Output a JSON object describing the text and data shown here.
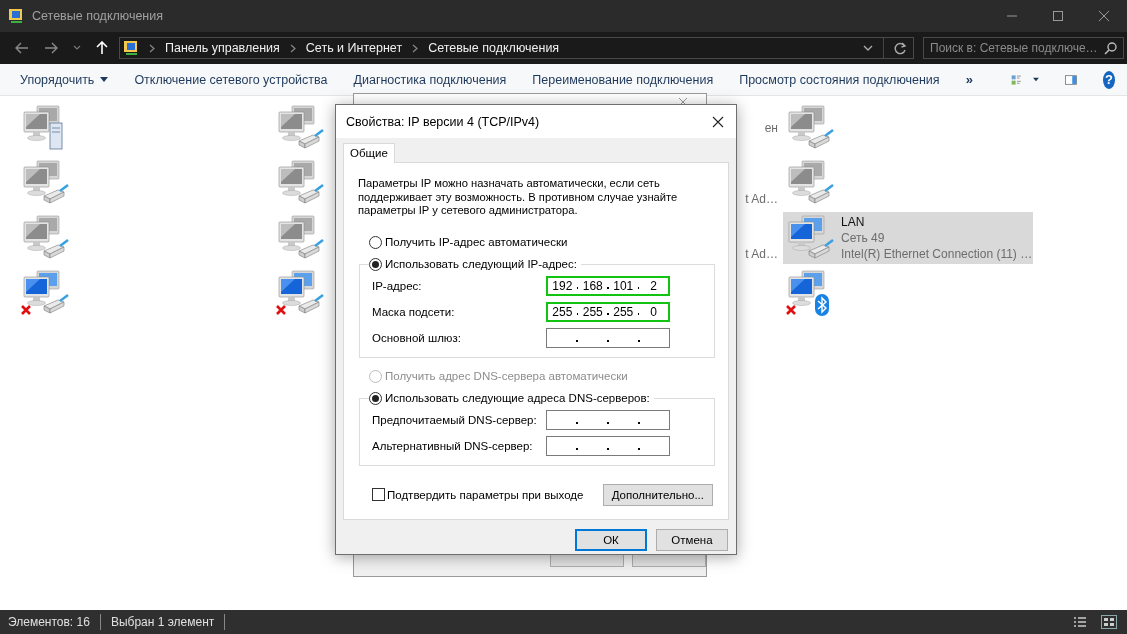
{
  "window": {
    "title": "Сетевые подключения"
  },
  "address_bar": {
    "breadcrumbs": [
      "Панель управления",
      "Сеть и Интернет",
      "Сетевые подключения"
    ]
  },
  "search": {
    "placeholder": "Поиск в: Сетевые подключе…"
  },
  "toolbar": {
    "items": [
      {
        "label": "Упорядочить",
        "kind": "dropdown"
      },
      {
        "label": "Отключение сетевого устройства",
        "kind": "command"
      },
      {
        "label": "Диагностика подключения",
        "kind": "command"
      },
      {
        "label": "Переименование подключения",
        "kind": "command"
      },
      {
        "label": "Просмотр состояния подключения",
        "kind": "command"
      }
    ],
    "overflow": "»",
    "help": "?"
  },
  "connections": {
    "columns": [
      [
        {
          "kind": "server",
          "connected": false,
          "disabled": false,
          "selected": false
        },
        {
          "kind": "ethernet",
          "connected": false,
          "disabled": false,
          "selected": false
        },
        {
          "kind": "ethernet",
          "connected": false,
          "disabled": false,
          "selected": false
        },
        {
          "kind": "ethernet",
          "connected": true,
          "disabled": true,
          "selected": false
        }
      ],
      [
        {
          "kind": "ethernet",
          "connected": false,
          "disabled": false,
          "selected": false
        },
        {
          "kind": "ethernet",
          "connected": false,
          "disabled": false,
          "selected": false
        },
        {
          "kind": "ethernet",
          "connected": false,
          "disabled": false,
          "selected": false
        },
        {
          "kind": "ethernet",
          "connected": true,
          "disabled": true,
          "selected": false
        }
      ],
      [
        {
          "status": "ен",
          "selected": false
        },
        {
          "adapter": "t Ad…",
          "selected": false
        },
        {
          "adapter": "t Ad…",
          "selected": false
        }
      ],
      [
        {
          "kind": "ethernet",
          "connected": false,
          "disabled": false,
          "selected": false
        },
        {
          "kind": "ethernet",
          "connected": false,
          "disabled": false,
          "selected": false
        },
        {
          "kind": "ethernet",
          "connected": true,
          "disabled": false,
          "selected": true,
          "name": "LAN",
          "status": "Сеть 49",
          "adapter": "Intel(R) Ethernet Connection (11) …"
        },
        {
          "kind": "bluetooth",
          "connected": true,
          "disabled": true,
          "selected": false
        }
      ]
    ]
  },
  "ip_dialog": {
    "title": "Свойства: IP версии 4 (TCP/IPv4)",
    "tabs": [
      {
        "label": "Общие",
        "selected": true
      }
    ],
    "description": "Параметры IP можно назначать автоматически, если сеть поддерживает эту возможность. В противном случае узнайте параметры IP у сетевого администратора.",
    "ip_section": {
      "auto_option": {
        "label": "Получить IP-адрес автоматически",
        "selected": false,
        "disabled": false
      },
      "manual_option": {
        "label": "Использовать следующий IP-адрес:",
        "selected": true,
        "disabled": false
      },
      "fields": [
        {
          "label": "IP-адрес:",
          "octets": [
            "192",
            "168",
            "101",
            "2"
          ],
          "highlighted": true
        },
        {
          "label": "Маска подсети:",
          "octets": [
            "255",
            "255",
            "255",
            "0"
          ],
          "highlighted": true
        },
        {
          "label": "Основной шлюз:",
          "highlighted": false
        }
      ]
    },
    "dns_section": {
      "auto_option": {
        "label": "Получить адрес DNS-сервера автоматически",
        "selected": false,
        "disabled": true
      },
      "manual_option": {
        "label": "Использовать следующие адреса DNS-серверов:",
        "selected": true,
        "disabled": false
      },
      "fields": [
        {
          "label": "Предпочитаемый DNS-сервер:",
          "highlighted": false
        },
        {
          "label": "Альтернативный DNS-сервер:",
          "highlighted": false
        }
      ]
    },
    "confirm_checkbox": {
      "label": "Подтвердить параметры при выходе",
      "checked": false
    },
    "advanced_button": "Дополнительно...",
    "buttons": [
      {
        "label": "ОК",
        "default": true
      },
      {
        "label": "Отмена",
        "default": false
      }
    ]
  },
  "status_bar": {
    "count": "Элементов: 16",
    "selection": "Выбран 1 элемент"
  }
}
